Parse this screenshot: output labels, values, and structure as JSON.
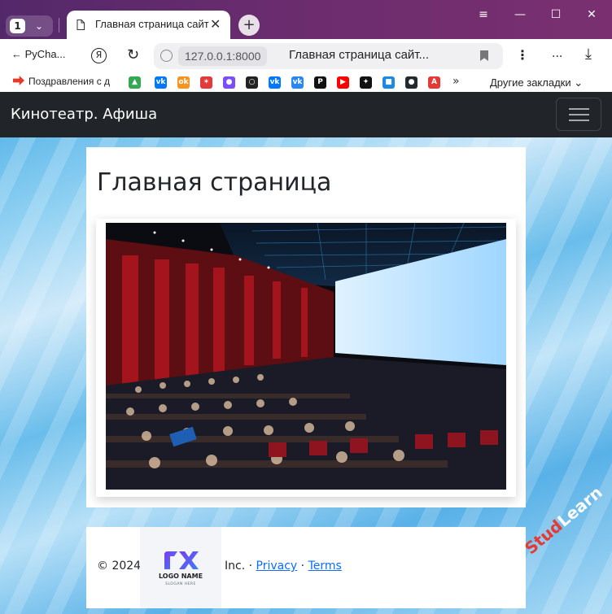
{
  "browser": {
    "tab_count": "1",
    "tab_title": "Главная страница сайт",
    "back_label": "PyCha...",
    "ya_label": "Я",
    "url_host": "127.0.0.1:8000",
    "page_title": "Главная страница сайт...",
    "ext_label": "...",
    "window_controls": {
      "menu": "≡",
      "minimize": "—",
      "maximize": "☐",
      "close": "✕"
    }
  },
  "bookmarks": {
    "first": "Поздравления с д",
    "items": [
      {
        "name": "google-drive",
        "color": "#34a853",
        "glyph": "▲"
      },
      {
        "name": "vk",
        "color": "#0077ff",
        "glyph": "vk"
      },
      {
        "name": "ok",
        "color": "#f7931e",
        "glyph": "ok"
      },
      {
        "name": "tools",
        "color": "#e23a3a",
        "glyph": "✶"
      },
      {
        "name": "dots",
        "color": "#7c4dff",
        "glyph": "●"
      },
      {
        "name": "circle",
        "color": "#222222",
        "glyph": "○"
      },
      {
        "name": "vk-2",
        "color": "#0077ff",
        "glyph": "vk"
      },
      {
        "name": "vk-3",
        "color": "#2787f5",
        "glyph": "vk"
      },
      {
        "name": "p",
        "color": "#111111",
        "glyph": "P"
      },
      {
        "name": "youtube",
        "color": "#ff0000",
        "glyph": "▶"
      },
      {
        "name": "star-app",
        "color": "#111111",
        "glyph": "✦"
      },
      {
        "name": "chat",
        "color": "#1e88e5",
        "glyph": "■"
      },
      {
        "name": "github",
        "color": "#24292e",
        "glyph": "●"
      },
      {
        "name": "pdf",
        "color": "#e53935",
        "glyph": "A"
      }
    ],
    "more": "»",
    "other": "Другие закладки"
  },
  "site": {
    "brand": "Кинотеатр. Афиша",
    "heading": "Главная страница",
    "footer": {
      "copyright": "© 2024",
      "logo_name": "LOGO NAME",
      "logo_slogan": "SLOGAN HERE",
      "inc": "Inc. · ",
      "privacy": "Privacy",
      "sep": " · ",
      "terms": "Terms"
    }
  },
  "watermark": {
    "part_a": "Stud",
    "part_b": "Learn"
  },
  "colors": {
    "navbar": "#212529",
    "link": "#0d6efd",
    "titlebar": "#5e2a6c"
  }
}
